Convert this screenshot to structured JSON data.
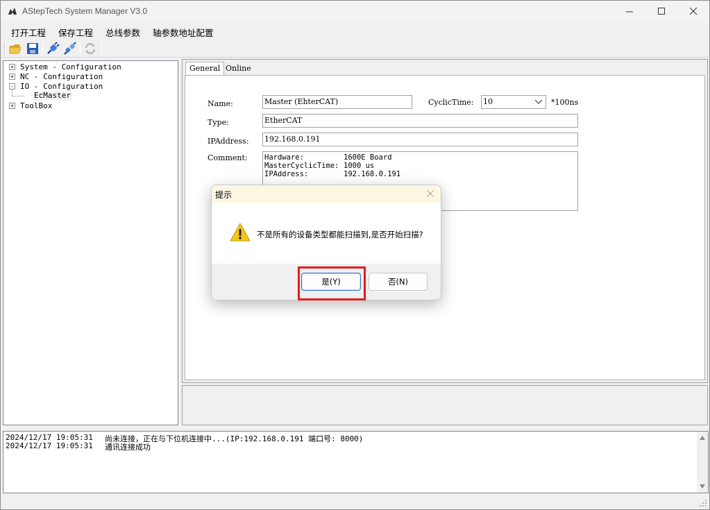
{
  "window": {
    "title": "AStepTech System Manager V3.0"
  },
  "menu": [
    "打开工程",
    "保存工程",
    "总线参数",
    "轴参数地址配置"
  ],
  "toolbar": {
    "icons": [
      "open-folder-icon",
      "save-disk-icon",
      "connect-plug-icon",
      "disconnect-plug-icon",
      "refresh-icon"
    ]
  },
  "tree": {
    "items": [
      {
        "label": "System - Configuration",
        "expander": "+"
      },
      {
        "label": "NC - Configuration",
        "expander": "+"
      },
      {
        "label": "IO - Configuration",
        "expander": "-"
      },
      {
        "label": "EcMaster",
        "expander": ""
      },
      {
        "label": "ToolBox",
        "expander": "+"
      }
    ]
  },
  "tabs": [
    "General",
    "Online"
  ],
  "form": {
    "name_label": "Name:",
    "name_value": "Master (EhterCAT)",
    "cyclic_label": "CyclicTime:",
    "cyclic_value": "10",
    "cyclic_unit": "*100ns",
    "type_label": "Type:",
    "type_value": "EtherCAT",
    "ip_label": "IPAddress:",
    "ip_value": "192.168.0.191",
    "comment_label": "Comment:",
    "comment_lines": [
      {
        "key": "Hardware:",
        "value": "1600E Board"
      },
      {
        "key": "MasterCyclicTime:",
        "value": "1000 us"
      },
      {
        "key": "IPAddress:",
        "value": "192.168.0.191"
      }
    ]
  },
  "log": [
    {
      "time": "2024/12/17 19:05:31",
      "msg": "尚未连接，正在与下位机连接中...(IP:192.168.0.191 端口号: 8000)"
    },
    {
      "time": "2024/12/17 19:05:31",
      "msg": "通讯连接成功"
    }
  ],
  "dialog": {
    "title": "提示",
    "message": "不是所有的设备类型都能扫描到,是否开始扫描?",
    "yes_label": "是(Y)",
    "no_label": "否(N)",
    "highlight_color": "#e61b1b"
  }
}
